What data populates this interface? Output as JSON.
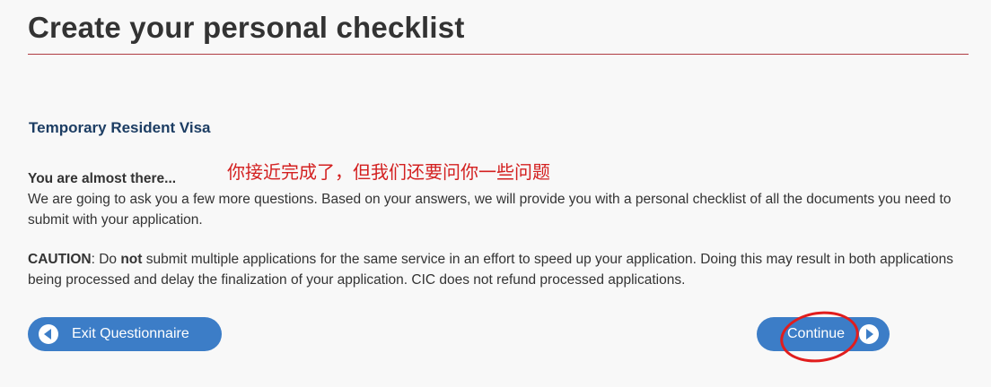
{
  "header": {
    "title": "Create your personal checklist"
  },
  "section": {
    "heading": "Temporary Resident Visa"
  },
  "annotation": {
    "text": "你接近完成了，但我们还要问你一些问题"
  },
  "intro": {
    "lead": "You are almost there...",
    "body": "We are going to ask you a few more questions. Based on your answers, we will provide you with a personal checklist of all the documents you need to submit with your application."
  },
  "caution": {
    "label": "CAUTION",
    "part1": ": Do ",
    "emphasis": "not",
    "part2": " submit multiple applications for the same service in an effort to speed up your application.  Doing this may result in both applications being processed and delay the finalization of your application. CIC does not refund processed applications."
  },
  "buttons": {
    "exit_label": "Exit Questionnaire",
    "continue_label": "Continue"
  },
  "colors": {
    "button_blue": "#3c7dc7",
    "rule_red": "#af3c43",
    "heading_navy": "#1c3d63",
    "annotation_red": "#d32020"
  },
  "icons": {
    "exit": "arrow-left-circle-icon",
    "continue": "arrow-right-circle-icon"
  }
}
